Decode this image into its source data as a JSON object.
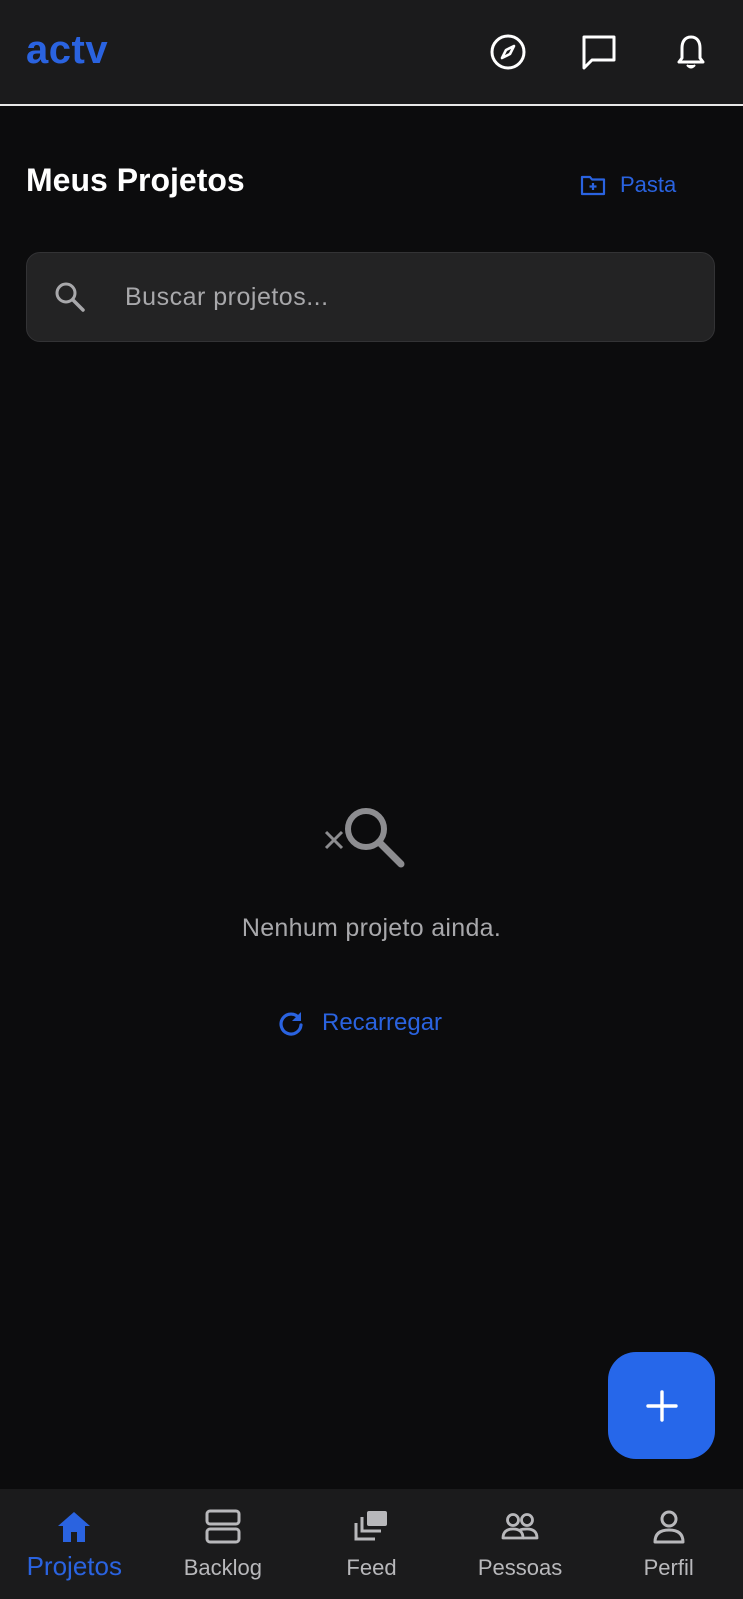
{
  "app": {
    "logo": "actv"
  },
  "colors": {
    "accent": "#2a63e0",
    "background": "#0c0c0d",
    "surface": "#1b1b1c",
    "muted": "#a8a8ab"
  },
  "topbar": {
    "icons": [
      "compass-icon",
      "chat-icon",
      "bell-icon"
    ]
  },
  "header": {
    "title": "Meus Projetos",
    "folder_label": "Pasta"
  },
  "search": {
    "placeholder": "Buscar projetos..."
  },
  "empty_state": {
    "message": "Nenhum projeto ainda.",
    "reload_label": "Recarregar"
  },
  "fab": {
    "icon": "plus-icon"
  },
  "bottom_nav": {
    "items": [
      {
        "label": "Projetos",
        "icon": "home-icon",
        "active": true
      },
      {
        "label": "Backlog",
        "icon": "backlog-icon",
        "active": false
      },
      {
        "label": "Feed",
        "icon": "feed-icon",
        "active": false
      },
      {
        "label": "Pessoas",
        "icon": "people-icon",
        "active": false
      },
      {
        "label": "Perfil",
        "icon": "profile-icon",
        "active": false
      }
    ]
  }
}
